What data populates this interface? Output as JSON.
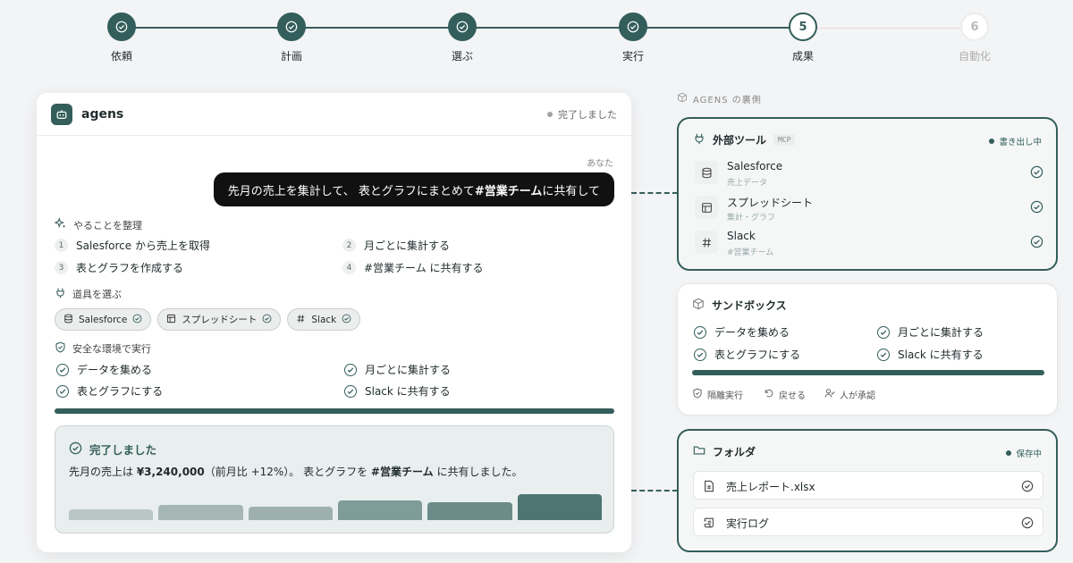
{
  "steps": [
    {
      "label": "依頼",
      "state": "done"
    },
    {
      "label": "計画",
      "state": "done"
    },
    {
      "label": "選ぶ",
      "state": "done"
    },
    {
      "label": "実行",
      "state": "done"
    },
    {
      "label": "成果",
      "state": "active",
      "number": "5"
    },
    {
      "label": "自動化",
      "state": "todo",
      "number": "6"
    }
  ],
  "app": {
    "name": "agens",
    "status": "完了しました"
  },
  "chat": {
    "sender_label": "あなた",
    "message_part1": "先月の売上を集計して、 表とグラフにまとめて ",
    "message_channel": "#営業チーム",
    "message_part2": " に共有して"
  },
  "plan": {
    "title": "やることを整理",
    "tasks": [
      {
        "num": "1",
        "text": "Salesforce から売上を取得"
      },
      {
        "num": "2",
        "text": "月ごとに集計する"
      },
      {
        "num": "3",
        "text": "表とグラフを作成する"
      },
      {
        "num": "4",
        "text": "#営業チーム に共有する"
      }
    ]
  },
  "tools": {
    "title": "道具を選ぶ",
    "chips": [
      {
        "label": "Salesforce",
        "icon": "database-icon"
      },
      {
        "label": "スプレッドシート",
        "icon": "table-icon"
      },
      {
        "label": "Slack",
        "icon": "hash-icon"
      }
    ]
  },
  "execution": {
    "title": "安全な環境で実行",
    "items": [
      "データを集める",
      "月ごとに集計する",
      "表とグラフにする",
      "Slack に共有する"
    ],
    "progress": 1.0
  },
  "result": {
    "title": "完了しました",
    "text_part1": "先月の売上は ",
    "amount": "¥3,240,000",
    "text_part2": "（前月比 +12%）。 表とグラフを ",
    "channel": "#営業チーム",
    "text_part3": " に共有しました。",
    "bar_values": [
      0.3,
      0.42,
      0.38,
      0.55,
      0.5,
      0.72
    ],
    "bar_colors": [
      "#b9c6c4",
      "#a5b6b3",
      "#9db0ad",
      "#7f9c98",
      "#6b8c88",
      "#4e7571"
    ]
  },
  "behind": {
    "label": "AGENS の裏側",
    "external": {
      "title": "外部ツール",
      "badge": "MCP",
      "status": "書き出し中",
      "rows": [
        {
          "name": "Salesforce",
          "sub": "売上データ",
          "icon": "database-icon"
        },
        {
          "name": "スプレッドシート",
          "sub": "集計・グラフ",
          "icon": "table-icon"
        },
        {
          "name": "Slack",
          "sub": "#営業チーム",
          "icon": "hash-icon"
        }
      ]
    },
    "sandbox": {
      "title": "サンドボックス",
      "items": [
        "データを集める",
        "月ごとに集計する",
        "表とグラフにする",
        "Slack に共有する"
      ],
      "progress": 1.0,
      "footer": [
        "隔離実行",
        "戻せる",
        "人が承認"
      ]
    },
    "folder": {
      "title": "フォルダ",
      "status": "保存中",
      "files": [
        "売上レポート.xlsx",
        "実行ログ"
      ]
    }
  },
  "colors": {
    "accent": "#335e5b",
    "bubble": "#111111"
  }
}
